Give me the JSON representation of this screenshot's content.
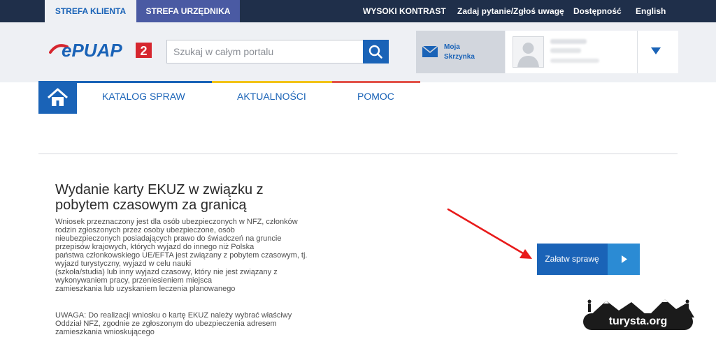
{
  "topbar": {
    "tabs": [
      "STREFA KLIENTA",
      "STREFA URZĘDNIKA"
    ],
    "links": [
      "WYSOKI KONTRAST",
      "Zadaj pytanie/Zgłoś uwagę",
      "Dostępność",
      "English"
    ]
  },
  "header": {
    "logo_text": "ePUAP",
    "logo_badge": "2",
    "search_placeholder": "Szukaj w całym portalu",
    "inbox_label_1": "Moja",
    "inbox_label_2": "Skrzynka"
  },
  "nav": {
    "items": [
      "KATALOG SPRAW",
      "AKTUALNOŚCI",
      "POMOC"
    ],
    "accent_colors": [
      "#1a63b7",
      "#f2c318",
      "#e2534a"
    ]
  },
  "main": {
    "title_line1": "Wydanie karty EKUZ w związku z",
    "title_line2": "pobytem czasowym za granicą",
    "description_lines": [
      "Wniosek przeznaczony jest dla osób ubezpieczonych w NFZ, członków",
      "rodzin zgłoszonych przez osoby ubezpieczone, osób",
      "nieubezpieczonych posiadających prawo do świadczeń na gruncie",
      "przepisów krajowych, których wyjazd do innego niż Polska",
      "państwa członkowskiego UE/EFTA jest związany z pobytem czasowym, tj.",
      "wyjazd turystyczny, wyjazd w celu nauki",
      "(szkoła/studia) lub inny wyjazd czasowy, który nie jest związany z",
      "wykonywaniem pracy, przeniesieniem miejsca",
      "zamieszkania lub uzyskaniem leczenia planowanego"
    ],
    "warning_lines": [
      "UWAGA: Do realizacji wniosku o kartę EKUZ należy wybrać właściwy",
      "Oddział NFZ, zgodnie ze zgłoszonym do ubezpieczenia adresem",
      "zamieszkania wnioskującego"
    ],
    "cta_label": "Załatw sprawę"
  },
  "watermark": {
    "text": "turysta.org"
  }
}
